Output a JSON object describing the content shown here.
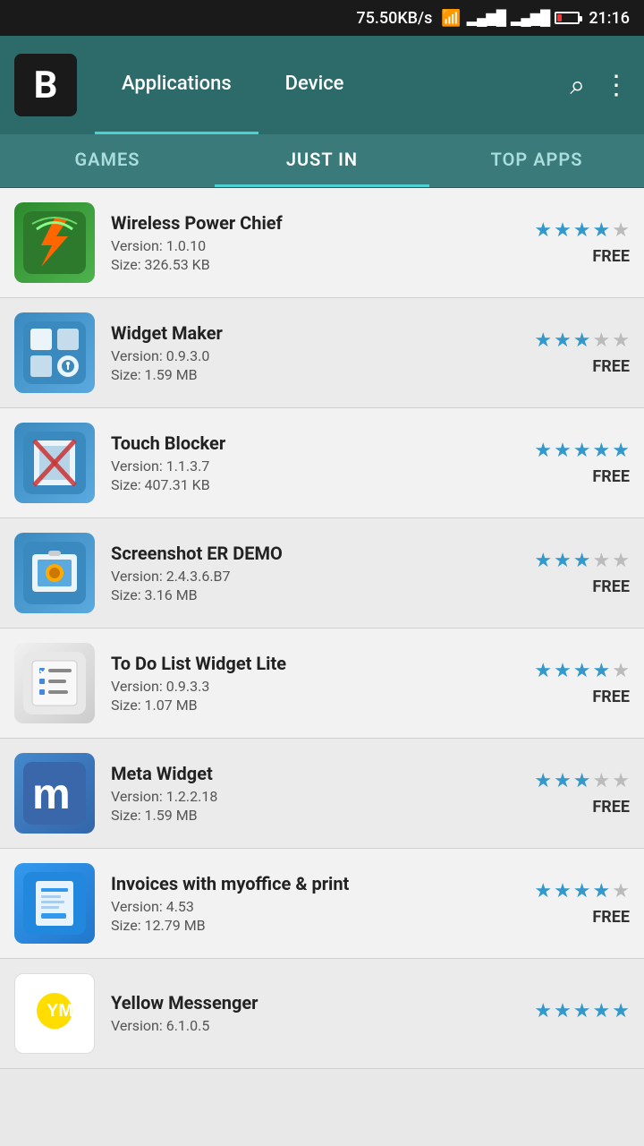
{
  "statusBar": {
    "speed": "75.50KB/s",
    "time": "21:16"
  },
  "header": {
    "logoText": "B",
    "tabs": [
      {
        "label": "Applications",
        "active": true
      },
      {
        "label": "Device",
        "active": false
      }
    ],
    "searchLabel": "search",
    "menuLabel": "menu"
  },
  "subTabs": [
    {
      "label": "GAMES",
      "active": false
    },
    {
      "label": "JUST IN",
      "active": true
    },
    {
      "label": "TOP APPS",
      "active": false
    }
  ],
  "apps": [
    {
      "name": "Wireless Power Chief",
      "version": "Version: 1.0.10",
      "size": "Size: 326.53 KB",
      "rating": 4,
      "maxRating": 5,
      "price": "FREE"
    },
    {
      "name": "Widget Maker",
      "version": "Version: 0.9.3.0",
      "size": "Size: 1.59 MB",
      "rating": 3,
      "maxRating": 5,
      "price": "FREE"
    },
    {
      "name": "Touch Blocker",
      "version": "Version: 1.1.3.7",
      "size": "Size: 407.31 KB",
      "rating": 5,
      "maxRating": 5,
      "price": "FREE"
    },
    {
      "name": "Screenshot ER DEMO",
      "version": "Version: 2.4.3.6.B7",
      "size": "Size: 3.16 MB",
      "rating": 3,
      "maxRating": 5,
      "price": "FREE"
    },
    {
      "name": "To Do List Widget Lite",
      "version": "Version: 0.9.3.3",
      "size": "Size: 1.07 MB",
      "rating": 4,
      "maxRating": 5,
      "price": "FREE"
    },
    {
      "name": "Meta Widget",
      "version": "Version: 1.2.2.18",
      "size": "Size: 1.59 MB",
      "rating": 3,
      "maxRating": 5,
      "price": "FREE"
    },
    {
      "name": "Invoices with myoffice & print",
      "version": "Version: 4.53",
      "size": "Size: 12.79 MB",
      "rating": 4,
      "maxRating": 5,
      "price": "FREE"
    },
    {
      "name": "Yellow Messenger",
      "version": "Version: 6.1.0.5",
      "size": "",
      "rating": 5,
      "maxRating": 5,
      "price": ""
    }
  ]
}
